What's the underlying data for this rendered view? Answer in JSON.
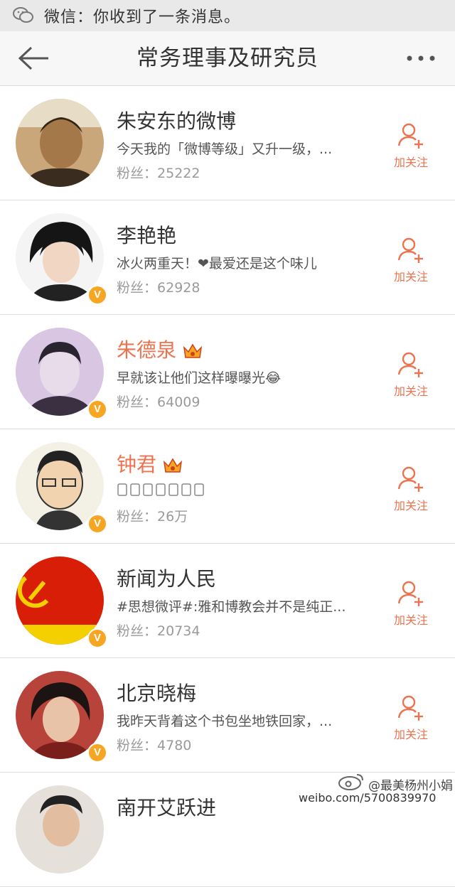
{
  "notification": {
    "text": "微信：你收到了一条消息。"
  },
  "header": {
    "title": "常务理事及研究员"
  },
  "follow_label": "加关注",
  "fans_prefix": "粉丝：",
  "accent_color": "#eb7350",
  "badge_color": "#f6a623",
  "users": [
    {
      "name": "朱安东的微博",
      "desc": "今天我的「微博等级」又升一级，...",
      "fans": "25222",
      "verified": false,
      "vip": false
    },
    {
      "name": "李艳艳",
      "desc": "冰火两重天！❤最爱还是这个味儿",
      "fans": "62928",
      "verified": true,
      "vip": false
    },
    {
      "name": "朱德泉",
      "desc": "早就该让他们这样曝曝光😂",
      "fans": "64009",
      "verified": true,
      "vip": true
    },
    {
      "name": "钟君",
      "desc": "",
      "fans": "26万",
      "verified": true,
      "vip": true
    },
    {
      "name": "新闻为人民",
      "desc": "#思想微评#:雅和博教会并不是纯正...",
      "fans": "20734",
      "verified": true,
      "vip": false
    },
    {
      "name": "北京晓梅",
      "desc": "我昨天背着这个书包坐地铁回家，...",
      "fans": "4780",
      "verified": true,
      "vip": false
    },
    {
      "name": "南开艾跃进",
      "desc": "",
      "fans": "",
      "verified": false,
      "vip": false
    }
  ],
  "watermark": {
    "handle": "@最美杨州小娟",
    "url": "weibo.com/5700839970"
  }
}
